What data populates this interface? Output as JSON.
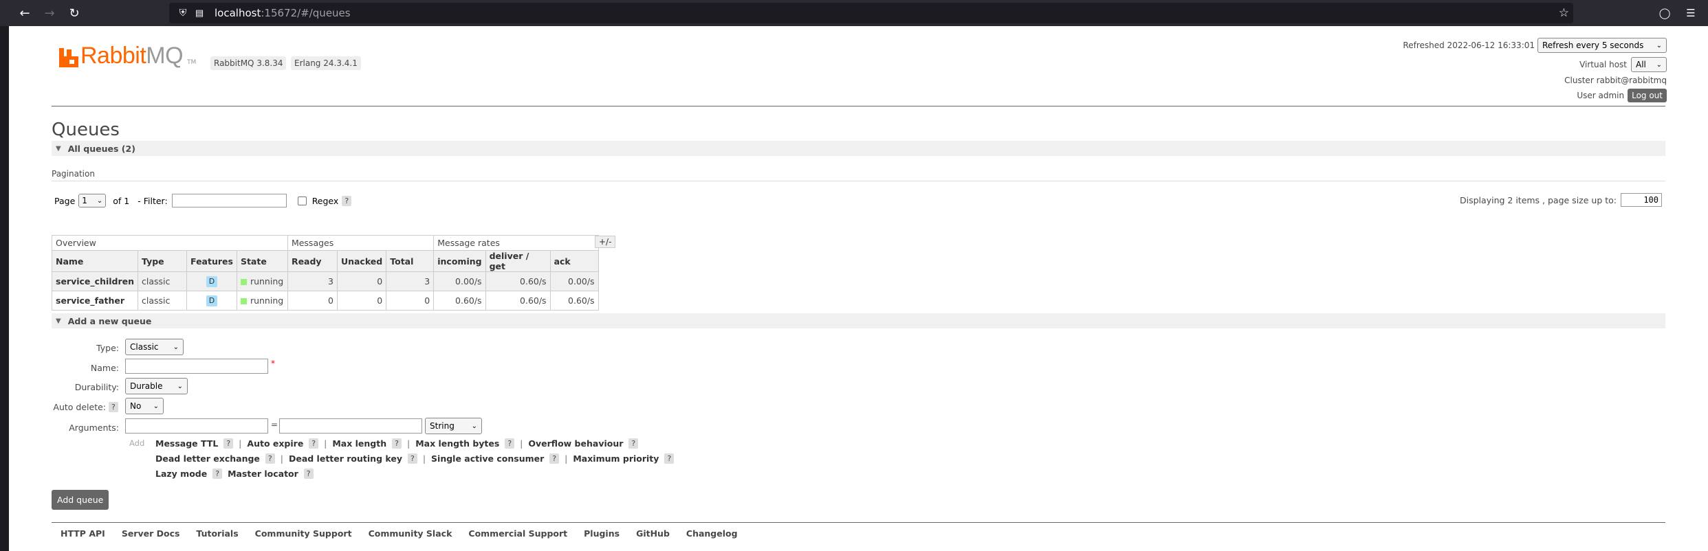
{
  "browser": {
    "url_host": "localhost",
    "url_rest": ":15672/#/queues"
  },
  "header": {
    "logo_rabbit": "Rabbit",
    "logo_mq": "MQ",
    "logo_tm": "TM",
    "rabbitmq_version": "RabbitMQ 3.8.34",
    "erlang_version": "Erlang 24.3.4.1",
    "refreshed_label": "Refreshed 2022-06-12 16:33:01",
    "refresh_select": "Refresh every 5 seconds",
    "vhost_label": "Virtual host",
    "vhost_select": "All",
    "cluster_label": "Cluster rabbit@rabbitmq",
    "user_label": "User admin",
    "logout_label": "Log out"
  },
  "page_title": "Queues",
  "all_queues_label": "All queues (2)",
  "pagination": {
    "section_label": "Pagination",
    "page_label": "Page",
    "page_select": "1",
    "of_label": "of 1",
    "filter_label": "- Filter:",
    "regex_label": "Regex",
    "help": "?",
    "display_label": "Displaying 2 items , page size up to:",
    "page_size": "100"
  },
  "table": {
    "groups": [
      "Overview",
      "Messages",
      "Message rates"
    ],
    "toggle": "+/-",
    "columns": [
      "Name",
      "Type",
      "Features",
      "State",
      "Ready",
      "Unacked",
      "Total",
      "incoming",
      "deliver / get",
      "ack"
    ],
    "rows": [
      {
        "name": "service_children",
        "type": "classic",
        "feature": "D",
        "state": "running",
        "ready": "3",
        "unacked": "0",
        "total": "3",
        "incoming": "0.00/s",
        "deliver": "0.60/s",
        "ack": "0.00/s"
      },
      {
        "name": "service_father",
        "type": "classic",
        "feature": "D",
        "state": "running",
        "ready": "0",
        "unacked": "0",
        "total": "0",
        "incoming": "0.60/s",
        "deliver": "0.60/s",
        "ack": "0.60/s"
      }
    ]
  },
  "add_queue": {
    "section_label": "Add a new queue",
    "type_label": "Type:",
    "type_value": "Classic",
    "name_label": "Name:",
    "required_mark": "*",
    "durability_label": "Durability:",
    "durability_value": "Durable",
    "auto_delete_label": "Auto delete:",
    "auto_delete_value": "No",
    "arguments_label": "Arguments:",
    "equals": "=",
    "arg_type_value": "String",
    "add_label": "Add",
    "arg_links_row1": [
      "Message TTL",
      "Auto expire",
      "Max length",
      "Max length bytes",
      "Overflow behaviour"
    ],
    "arg_links_row2": [
      "Dead letter exchange",
      "Dead letter routing key",
      "Single active consumer",
      "Maximum priority"
    ],
    "arg_links_row3": [
      "Lazy mode",
      "Master locator"
    ],
    "separator": "|",
    "submit_label": "Add queue"
  },
  "footer": [
    "HTTP API",
    "Server Docs",
    "Tutorials",
    "Community Support",
    "Community Slack",
    "Commercial Support",
    "Plugins",
    "GitHub",
    "Changelog"
  ]
}
